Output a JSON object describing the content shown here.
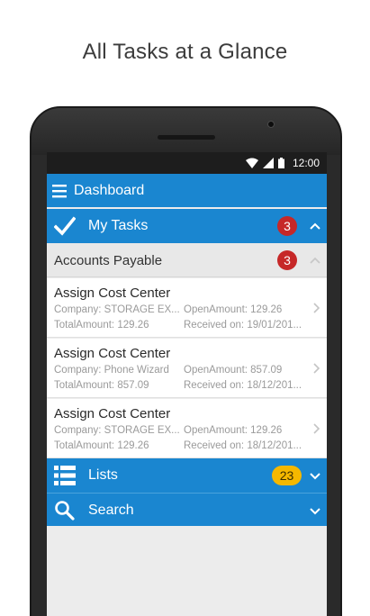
{
  "headline": "All Tasks at a Glance",
  "status_bar": {
    "time": "12:00"
  },
  "app_bar": {
    "title": "Dashboard"
  },
  "my_tasks": {
    "label": "My Tasks",
    "count": "3"
  },
  "accounts_payable": {
    "label": "Accounts Payable",
    "count": "3"
  },
  "tasks": [
    {
      "title": "Assign Cost Center",
      "company": "Company: STORAGE EX...",
      "open_amount": "OpenAmount: 129.26",
      "total_amount": "TotalAmount: 129.26",
      "received": "Received on: 19/01/201..."
    },
    {
      "title": "Assign Cost Center",
      "company": "Company: Phone Wizard",
      "open_amount": "OpenAmount: 857.09",
      "total_amount": "TotalAmount: 857.09",
      "received": "Received on: 18/12/201..."
    },
    {
      "title": "Assign Cost Center",
      "company": "Company: STORAGE EX...",
      "open_amount": "OpenAmount: 129.26",
      "total_amount": "TotalAmount: 129.26",
      "received": "Received on: 18/12/201..."
    }
  ],
  "lists": {
    "label": "Lists",
    "count": "23"
  },
  "search": {
    "label": "Search"
  },
  "colors": {
    "primary": "#1a86d0",
    "badge_red": "#c62828",
    "badge_yellow": "#f5b800"
  },
  "icons": [
    "wifi-icon",
    "signal-icon",
    "battery-icon",
    "menu-icon",
    "checkmark-icon",
    "list-icon",
    "search-icon",
    "chevron-up-icon",
    "chevron-down-icon",
    "chevron-right-icon"
  ]
}
